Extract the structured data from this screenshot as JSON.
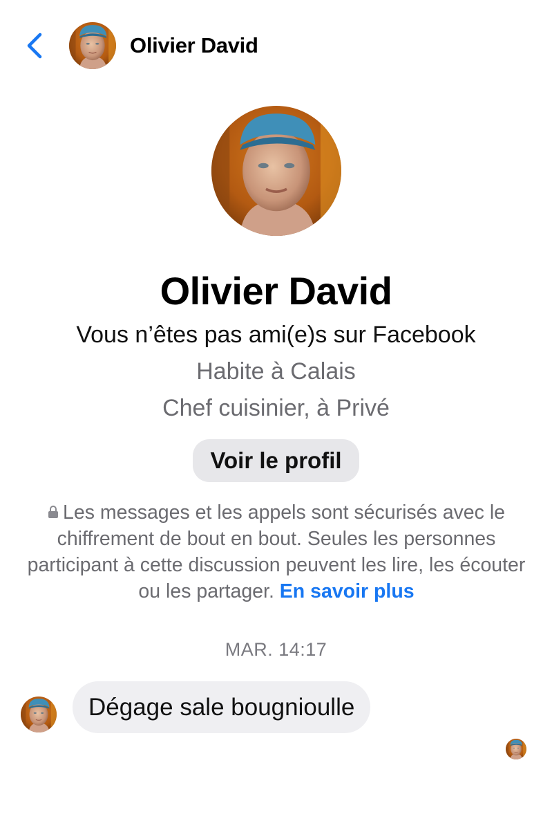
{
  "header": {
    "back_icon": "chevron-left-icon",
    "name": "Olivier David"
  },
  "profile": {
    "name": "Olivier David",
    "friend_status": "Vous n’êtes pas ami(e)s sur Facebook",
    "location": "Habite à Calais",
    "job": "Chef cuisinier, à Privé",
    "view_profile_label": "Voir le profil"
  },
  "notice": {
    "icon": "lock-icon",
    "text": "Les messages et les appels sont sécurisés avec le chiffrement de bout en bout. Seules les personnes participant à cette discussion peuvent les lire, les écouter ou les partager.",
    "link_text": "En savoir plus"
  },
  "conversation": {
    "timestamp": "MAR. 14:17",
    "messages": [
      {
        "text": "Dégage sale bougnioulle"
      }
    ]
  },
  "colors": {
    "accent": "#1877f2",
    "secondary_text": "#6b6b70",
    "bubble": "#efeff2",
    "button": "#e7e7ea"
  }
}
